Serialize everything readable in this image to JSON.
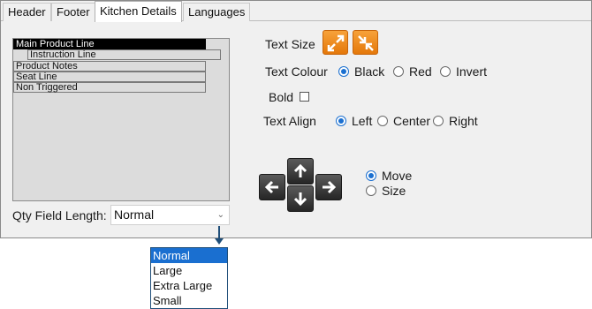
{
  "tabs": [
    {
      "label": "Header",
      "active": false
    },
    {
      "label": "Footer",
      "active": false
    },
    {
      "label": "Kitchen Details",
      "active": true
    },
    {
      "label": "Languages",
      "active": false
    }
  ],
  "preview": {
    "lines": [
      {
        "label": "Main Product Line",
        "selected": true
      },
      {
        "label": "Instruction Line",
        "selected": false
      },
      {
        "label": "Product Notes",
        "selected": false
      },
      {
        "label": "Seat Line",
        "selected": false
      },
      {
        "label": "Non Triggered",
        "selected": false
      }
    ]
  },
  "text_size": {
    "label": "Text Size"
  },
  "text_colour": {
    "label": "Text Colour",
    "options": [
      {
        "label": "Black",
        "selected": true
      },
      {
        "label": "Red",
        "selected": false
      },
      {
        "label": "Invert",
        "selected": false
      }
    ]
  },
  "bold": {
    "label": "Bold",
    "checked": false
  },
  "text_align": {
    "label": "Text Align",
    "options": [
      {
        "label": "Left",
        "selected": true
      },
      {
        "label": "Center",
        "selected": false
      },
      {
        "label": "Right",
        "selected": false
      }
    ]
  },
  "mode": {
    "options": [
      {
        "label": "Move",
        "selected": true
      },
      {
        "label": "Size",
        "selected": false
      }
    ]
  },
  "qty_field": {
    "label": "Qty Field Length:",
    "value": "Normal",
    "options": [
      "Normal",
      "Large",
      "Extra Large",
      "Small"
    ],
    "highlighted": "Normal"
  },
  "colors": {
    "accent": "#1a6fd0",
    "icon_orange": "#f08a1a",
    "callout": "#1f4e79"
  }
}
